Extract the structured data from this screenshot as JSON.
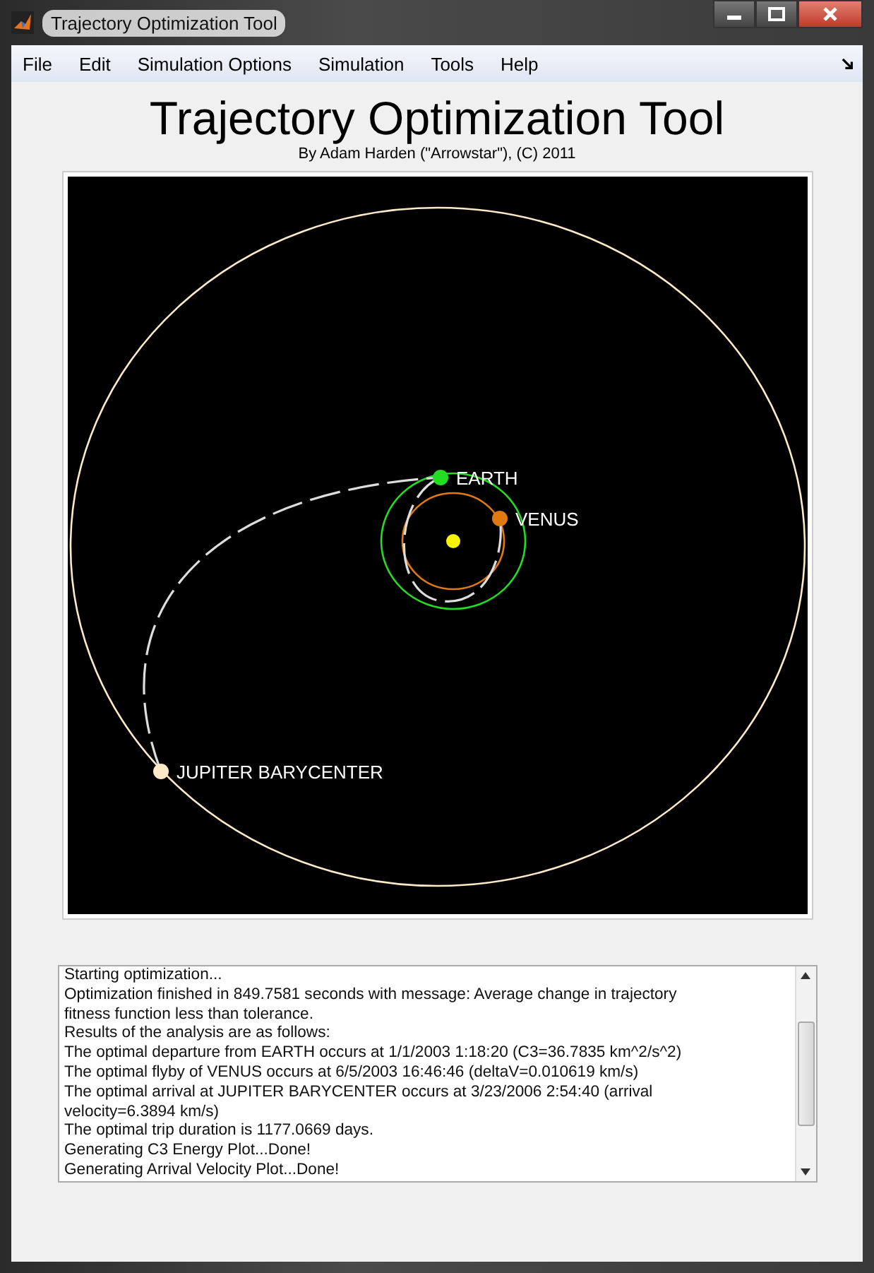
{
  "window": {
    "title": "Trajectory Optimization Tool"
  },
  "menu": [
    "File",
    "Edit",
    "Simulation Options",
    "Simulation",
    "Tools",
    "Help"
  ],
  "header": {
    "title": "Trajectory Optimization Tool",
    "subtitle": "By Adam Harden (\"Arrowstar\"), (C) 2011"
  },
  "plot": {
    "bodies": [
      {
        "name": "EARTH",
        "color": "#22dd22",
        "kind": "departure"
      },
      {
        "name": "VENUS",
        "color": "#e07a10",
        "kind": "flyby"
      },
      {
        "name": "JUPITER BARYCENTER",
        "color": "#fbe9c8",
        "kind": "arrival"
      }
    ]
  },
  "log": {
    "lines": [
      "Starting optimization...",
      "Optimization finished in 849.7581 seconds with message: Average change in trajectory fitness function less than tolerance.",
      "Results of the analysis are as follows:",
      "The optimal departure from EARTH occurs at 1/1/2003 1:18:20 (C3=36.7835 km^2/s^2)",
      "The optimal flyby of VENUS occurs at 6/5/2003 16:46:46 (deltaV=0.010619 km/s)",
      "The optimal arrival at JUPITER BARYCENTER occurs at 3/23/2006 2:54:40 (arrival velocity=6.3894 km/s)",
      "The optimal trip duration is 1177.0669 days.",
      "Generating C3 Energy Plot...Done!",
      "Generating Arrival Velocity Plot...Done!"
    ]
  }
}
